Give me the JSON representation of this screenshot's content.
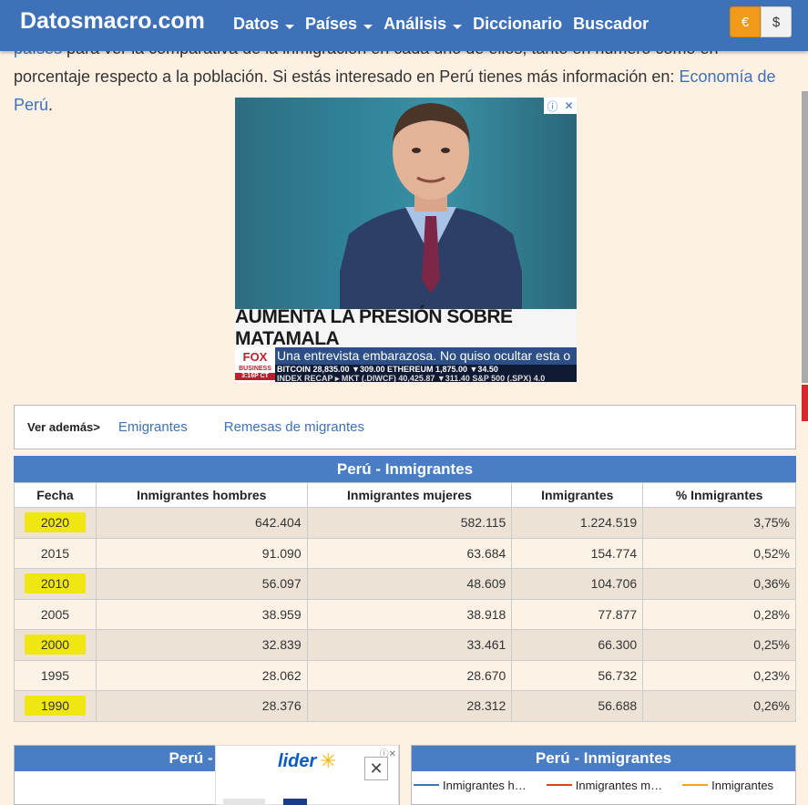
{
  "header": {
    "logo": "Datosmacro.com",
    "nav": [
      {
        "label": "Datos",
        "dropdown": true
      },
      {
        "label": "Países",
        "dropdown": true
      },
      {
        "label": "Análisis",
        "dropdown": true
      },
      {
        "label": "Diccionario",
        "dropdown": false
      },
      {
        "label": "Buscador",
        "dropdown": false
      }
    ],
    "currency": {
      "eur": "€",
      "usd": "$"
    }
  },
  "intro": {
    "text_link_start": "países",
    "text_partial": " para ver la comparativa de la inmigración en cada uno de ellos, tanto en número como en porcentaje respecto a la población. Si estás interesado en Perú tienes más información en: ",
    "link": "Economía de Perú",
    "end": "."
  },
  "ad": {
    "headline": "AUMENTA LA PRESIÓN SOBRE MATAMALA",
    "sub": "Una entrevista embarazosa. No quiso ocultar esta o",
    "logo_top": "FOX",
    "logo_bottom": "BUSINESS",
    "ticker1": "BITCOIN 28,835.00 ▼309.00 ETHEREUM 1,875.00 ▼34.50",
    "ticker2": "INDEX RECAP ▸ MKT (.DIWCF) 40,425.87 ▼311.40 S&P 500 (.SPX) 4.0",
    "time": "3:16P CT",
    "info": "ⓘ",
    "close": "✕"
  },
  "see_also": {
    "label": "Ver además>",
    "links": [
      "Emigrantes",
      "Remesas de migrantes"
    ]
  },
  "table": {
    "title": "Perú - Inmigrantes",
    "columns": [
      "Fecha",
      "Inmigrantes hombres",
      "Inmigrantes mujeres",
      "Inmigrantes",
      "% Inmigrantes"
    ],
    "rows": [
      {
        "fecha": "2020",
        "hombres": "642.404",
        "mujeres": "582.115",
        "total": "1.224.519",
        "pct": "3,75%",
        "highlight": true
      },
      {
        "fecha": "2015",
        "hombres": "91.090",
        "mujeres": "63.684",
        "total": "154.774",
        "pct": "0,52%",
        "highlight": false
      },
      {
        "fecha": "2010",
        "hombres": "56.097",
        "mujeres": "48.609",
        "total": "104.706",
        "pct": "0,36%",
        "highlight": true
      },
      {
        "fecha": "2005",
        "hombres": "38.959",
        "mujeres": "38.918",
        "total": "77.877",
        "pct": "0,28%",
        "highlight": false
      },
      {
        "fecha": "2000",
        "hombres": "32.839",
        "mujeres": "33.461",
        "total": "66.300",
        "pct": "0,25%",
        "highlight": true
      },
      {
        "fecha": "1995",
        "hombres": "28.062",
        "mujeres": "28.670",
        "total": "56.732",
        "pct": "0,23%",
        "highlight": false
      },
      {
        "fecha": "1990",
        "hombres": "28.376",
        "mujeres": "28.312",
        "total": "56.688",
        "pct": "0,26%",
        "highlight": true
      }
    ]
  },
  "charts": {
    "left_title": "Perú - Inm",
    "right_title": "Perú - Inmigrantes",
    "legend": [
      {
        "label": "Inmigrantes h…",
        "color": "#3e71b8"
      },
      {
        "label": "Inmigrantes m…",
        "color": "#d9441c"
      },
      {
        "label": "Inmigrantes",
        "color": "#f5a11a"
      }
    ]
  },
  "ad2": {
    "brand": "lider",
    "info": "ⓘ✕",
    "close": "✕"
  },
  "colors": {
    "brand_blue": "#3e71b8",
    "highlight_yellow": "#f0e612",
    "page_bg": "#fdf1e3"
  }
}
